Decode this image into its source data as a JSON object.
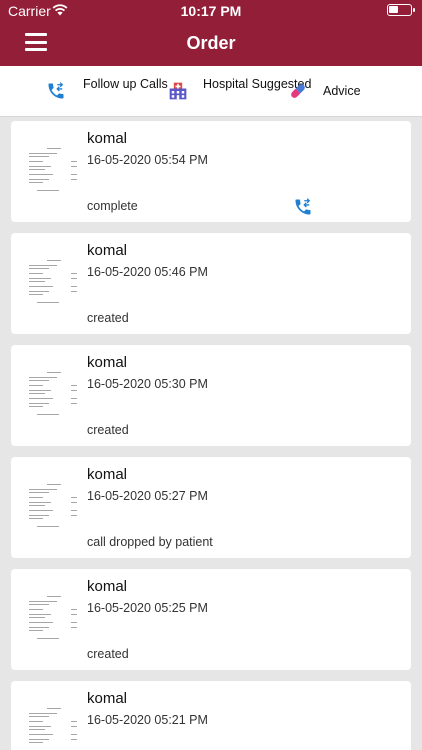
{
  "status_bar": {
    "carrier": "Carrier",
    "time": "10:17 PM"
  },
  "header": {
    "title": "Order",
    "menu_icon": "hamburger-menu-icon"
  },
  "tabs": [
    {
      "label": "Follow up Calls",
      "icon": "phone-callback-icon"
    },
    {
      "label": "Hospital Suggested",
      "icon": "hospital-icon"
    },
    {
      "label": "Advice",
      "icon": "pill-icon"
    }
  ],
  "orders": [
    {
      "name": "komal",
      "date": "16-05-2020 05:54 PM",
      "status": "complete",
      "has_call": true
    },
    {
      "name": "komal",
      "date": "16-05-2020 05:46 PM",
      "status": "created"
    },
    {
      "name": "komal",
      "date": "16-05-2020 05:30 PM",
      "status": "created"
    },
    {
      "name": "komal",
      "date": "16-05-2020 05:27 PM",
      "status": "call dropped by patient"
    },
    {
      "name": "komal",
      "date": "16-05-2020 05:25 PM",
      "status": "created"
    },
    {
      "name": "komal",
      "date": "16-05-2020 05:21 PM",
      "status": ""
    }
  ],
  "colors": {
    "brand": "#921e38",
    "call_icon": "#1f7fd1",
    "background": "#e6e6e6"
  }
}
